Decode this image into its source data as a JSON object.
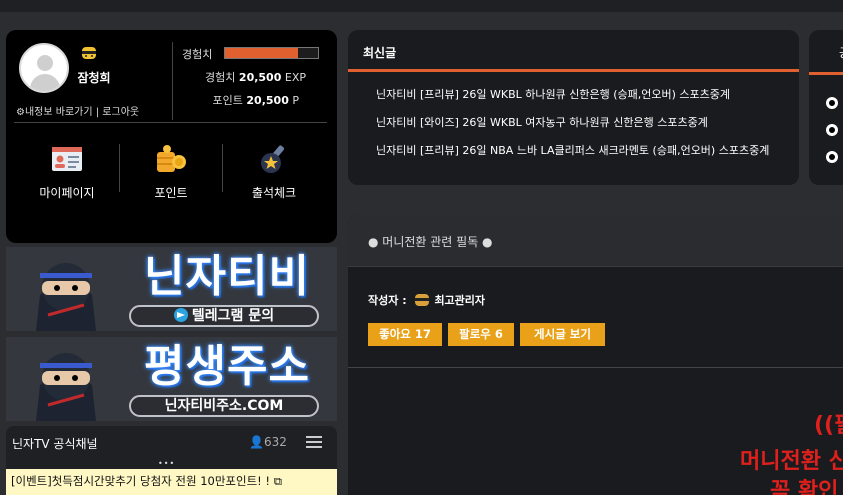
{
  "profile": {
    "nickname": "잠청희",
    "exp_label": "경험치",
    "exp_percent": 78,
    "exp_text_label": "경험치",
    "exp_value": "20,500",
    "exp_unit": "EXP",
    "point_label": "포인트",
    "point_value": "20,500",
    "point_unit": "P",
    "link_myinfo": "내정보 바로가기",
    "link_logout": "로그아웃",
    "menu": [
      {
        "label": "마이페이지",
        "icon": "id-card-icon"
      },
      {
        "label": "포인트",
        "icon": "coins-icon"
      },
      {
        "label": "출석체크",
        "icon": "star-stamp-icon"
      }
    ]
  },
  "banners": [
    {
      "title": "닌자티비",
      "subtitle": "텔레그램 문의"
    },
    {
      "title": "평생주소",
      "subtitle": "닌자티비주소.COM"
    }
  ],
  "channel": {
    "title": "닌자TV 공식채널",
    "member_count": "632",
    "dots": "•••",
    "notice": "[이벤트]첫득점시간맞추기 당첨자 전원 10만포인트! !"
  },
  "latest": {
    "title": "최신글",
    "posts": [
      "닌자티비 [프리뷰] 26일 WKBL 하나원큐 신한은행 (승패,언오버) 스포츠중계",
      "닌자티비 [와이즈] 26일 WKBL 여자농구 하나원큐 신한은행 스포츠중계",
      "닌자티비 [프리뷰] 26일 NBA 느바 LA클리퍼스 새크라멘토 (승패,언오버) 스포츠중계"
    ]
  },
  "side": {
    "title": "공"
  },
  "post": {
    "heading": "● 머니전환 관련 필독 ●",
    "author_label": "작성자 :",
    "author": "최고관리자",
    "like_label": "좋아요 17",
    "follow_label": "팔로우 6",
    "posts_label": "게시글 보기",
    "notice_line1": "((필",
    "notice_line2": "머니전환 신",
    "notice_line3": "꼭 확인"
  },
  "colors": {
    "accent": "#e0602f",
    "button": "#e8a118",
    "red_text": "#e0201c"
  }
}
